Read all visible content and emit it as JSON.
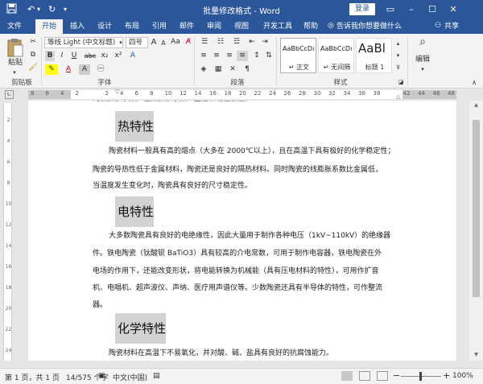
{
  "window": {
    "title": "批量修改格式 - Word",
    "login": "登录"
  },
  "tabs": [
    {
      "label": "文件"
    },
    {
      "label": "开始"
    },
    {
      "label": "插入"
    },
    {
      "label": "设计"
    },
    {
      "label": "布局"
    },
    {
      "label": "引用"
    },
    {
      "label": "邮件"
    },
    {
      "label": "审阅"
    },
    {
      "label": "视图"
    },
    {
      "label": "开发工具"
    },
    {
      "label": "帮助"
    }
  ],
  "tell_me": "告诉我你想要做什么",
  "share": "共享",
  "ribbon": {
    "clipboard": {
      "paste": "粘贴",
      "label": "剪贴板"
    },
    "font": {
      "name": "等线 Light (中文标题)",
      "size": "四号",
      "grow": "A",
      "shrink": "A",
      "case": "Aa",
      "label": "字体",
      "bold": "B",
      "italic": "I",
      "underline": "U",
      "strike": "abc",
      "sub": "x₂",
      "sup": "x²"
    },
    "paragraph": {
      "label": "段落"
    },
    "styles": {
      "label": "样式",
      "items": [
        {
          "preview": "AaBbCcDı",
          "name": "↵ 正文"
        },
        {
          "preview": "AaBbCcDı",
          "name": "↵ 无间隔"
        },
        {
          "preview": "AaBl",
          "name": "标题 1"
        }
      ]
    },
    "editing": {
      "label": "编辑"
    }
  },
  "ruler": {
    "numbers": [
      "8",
      "6",
      "4",
      "2",
      "",
      "2",
      "4",
      "6",
      "8",
      "10",
      "12",
      "14",
      "16",
      "18",
      "20",
      "22",
      "24",
      "26",
      "28",
      "30",
      "32",
      "34",
      "36",
      "38",
      "",
      "42",
      "44",
      "46",
      "48"
    ]
  },
  "document": {
    "clipped_top": "的热膨胀系数，但热膨胀系数、塑性和韧性很低。",
    "sections": [
      {
        "heading": "热特性",
        "lines": [
          "陶瓷材料一般具有高的熔点（大多在 2000℃以上），且在高温下具有极好的化学稳定性；",
          "陶瓷的导热性低于金属材料，陶瓷还是良好的隔热材料。同时陶瓷的线膨胀系数比金属低，",
          "当温度发生变化时，陶瓷具有良好的尺寸稳定性。"
        ]
      },
      {
        "heading": "电特性",
        "lines": [
          "大多数陶瓷具有良好的电绝缘性，因此大量用于制作各种电压（1kV~110kV）的绝缘器",
          "件。铁电陶瓷（钛酸钡 BaTiO3）具有较高的介电常数，可用于制作电容器，铁电陶瓷在外",
          "电场的作用下，还能改变形状，将电能转换为机械能（具有压电材料的特性），可用作扩音",
          "机、电唱机、超声波仪、声纳、医疗用声谱仪等。少数陶瓷还具有半导体的特性，可作整流",
          "器。"
        ]
      },
      {
        "heading": "化学特性",
        "lines": [
          "陶瓷材料在高温下不易氧化，并对酸、碱、盐具有良好的抗腐蚀能力。"
        ]
      }
    ]
  },
  "status": {
    "page": "第 1 页，共 1 页",
    "words": "14/575 个字",
    "lang": "中文(中国)",
    "zoom_minus": "−",
    "zoom_plus": "+",
    "zoom": "100%"
  },
  "colors": {
    "brand": "#2b579a",
    "highlight": "#d3d3d3"
  }
}
